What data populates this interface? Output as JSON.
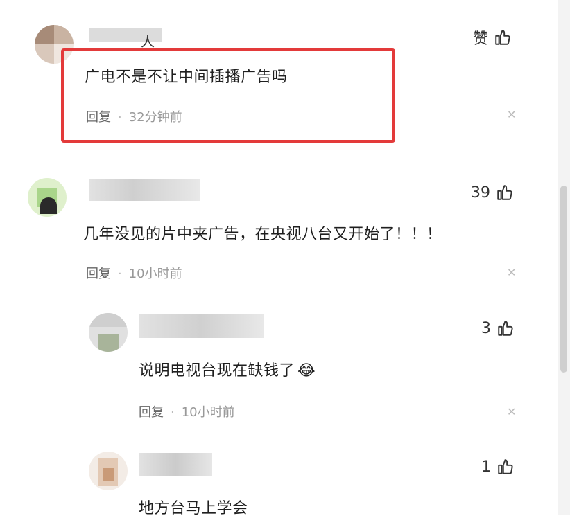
{
  "comments": [
    {
      "text": "广电不是不让中间插播广告吗",
      "reply_label": "回复",
      "time": "32分钟前",
      "likes": "赞",
      "author_fragment": "人"
    },
    {
      "text": "几年没见的片中夹广告，在央视八台又开始了！！！",
      "reply_label": "回复",
      "time": "10小时前",
      "likes": "39"
    },
    {
      "text": "说明电视台现在缺钱了",
      "emoji": "😂",
      "reply_label": "回复",
      "time": "10小时前",
      "likes": "3"
    },
    {
      "text": "地方台马上学会",
      "likes": "1"
    }
  ],
  "icons": {
    "like": "thumbs-up-icon",
    "close": "close-icon"
  },
  "colors": {
    "highlight_border": "#e33a3a",
    "meta_text": "#666666",
    "time_text": "#999999"
  }
}
